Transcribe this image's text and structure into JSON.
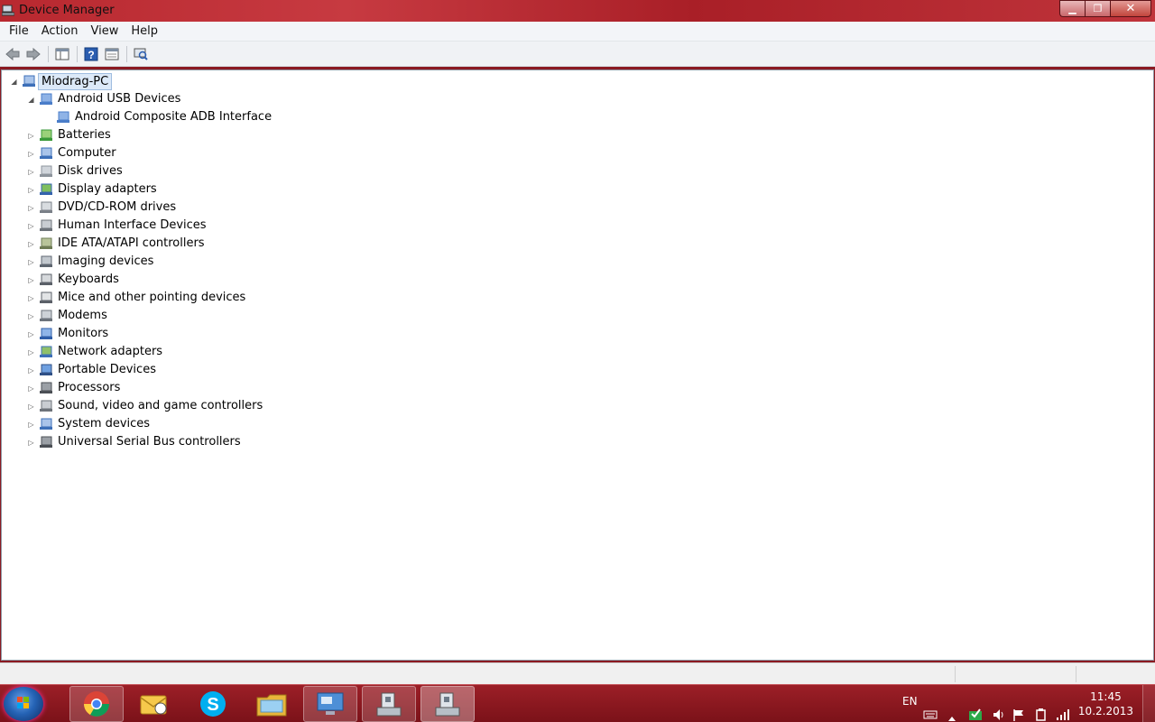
{
  "window": {
    "title": "Device Manager",
    "controls": {
      "minimize": "▁",
      "maximize": "❐",
      "close": "✕"
    }
  },
  "menu": [
    "File",
    "Action",
    "View",
    "Help"
  ],
  "toolbar": {
    "buttons": [
      "back-icon",
      "forward-icon",
      "show-hide-console-tree-icon",
      "help-icon",
      "properties-icon",
      "scan-hardware-icon"
    ]
  },
  "tree": {
    "root": "Miodrag-PC",
    "categories": [
      {
        "label": "Android USB Devices",
        "icon": "usb-device-icon",
        "expanded": true,
        "children": [
          "Android Composite ADB Interface"
        ]
      },
      {
        "label": "Batteries",
        "icon": "battery-icon"
      },
      {
        "label": "Computer",
        "icon": "computer-icon"
      },
      {
        "label": "Disk drives",
        "icon": "disk-drive-icon"
      },
      {
        "label": "Display adapters",
        "icon": "display-adapter-icon"
      },
      {
        "label": "DVD/CD-ROM drives",
        "icon": "dvd-drive-icon"
      },
      {
        "label": "Human Interface Devices",
        "icon": "hid-icon"
      },
      {
        "label": "IDE ATA/ATAPI controllers",
        "icon": "ide-controller-icon"
      },
      {
        "label": "Imaging devices",
        "icon": "imaging-device-icon"
      },
      {
        "label": "Keyboards",
        "icon": "keyboard-icon"
      },
      {
        "label": "Mice and other pointing devices",
        "icon": "mouse-icon"
      },
      {
        "label": "Modems",
        "icon": "modem-icon"
      },
      {
        "label": "Monitors",
        "icon": "monitor-icon"
      },
      {
        "label": "Network adapters",
        "icon": "network-adapter-icon"
      },
      {
        "label": "Portable Devices",
        "icon": "portable-device-icon"
      },
      {
        "label": "Processors",
        "icon": "processor-icon"
      },
      {
        "label": "Sound, video and game controllers",
        "icon": "sound-icon"
      },
      {
        "label": "System devices",
        "icon": "system-device-icon"
      },
      {
        "label": "Universal Serial Bus controllers",
        "icon": "usb-controller-icon"
      }
    ]
  },
  "taskbar": {
    "apps": [
      "chrome-icon",
      "mail-icon",
      "skype-icon",
      "explorer-icon",
      "remote-desktop-icon",
      "device-manager-icon",
      "device-manager-icon"
    ],
    "language": "EN",
    "clock": {
      "time": "11:45",
      "date": "10.2.2013"
    }
  },
  "colors": {
    "accent": "#b8282f",
    "selection": "#dce9f8"
  }
}
